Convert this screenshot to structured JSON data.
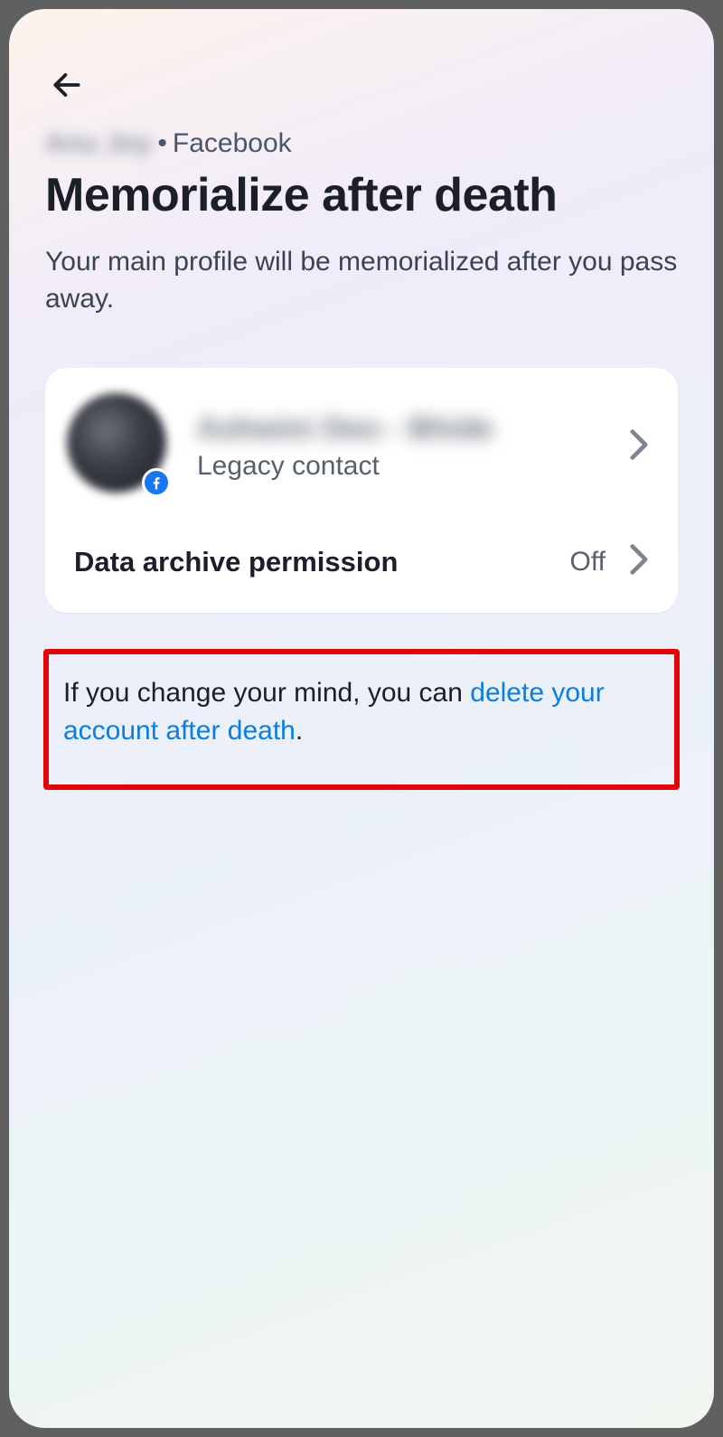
{
  "breadcrumb": {
    "user_name": "Anu Joy",
    "platform": "Facebook"
  },
  "page": {
    "title": "Memorialize after death",
    "subtitle": "Your main profile will be memorialized after you pass away."
  },
  "card": {
    "legacy_contact": {
      "name": "Ashwini Deo - Bhide",
      "label": "Legacy contact"
    },
    "data_archive": {
      "label": "Data archive permission",
      "value": "Off"
    }
  },
  "footer": {
    "change_mind_prefix": "If you change your mind, you can ",
    "change_mind_link": "delete your account after death",
    "change_mind_suffix": "."
  },
  "colors": {
    "link": "#0a7de0",
    "highlight_border": "#e00509",
    "fb_badge": "#1877f2"
  }
}
